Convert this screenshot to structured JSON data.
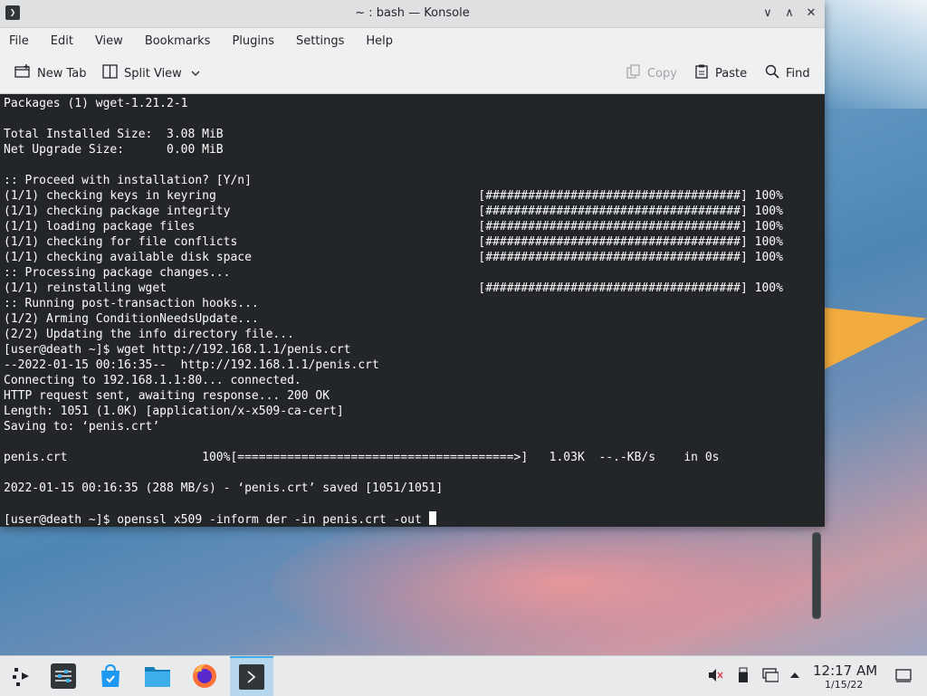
{
  "window": {
    "title": "~ : bash — Konsole",
    "app_icon_glyph": "❯",
    "controls": {
      "minimize": "∨",
      "maximize": "∧",
      "close": "✕"
    }
  },
  "menu": [
    "File",
    "Edit",
    "View",
    "Bookmarks",
    "Plugins",
    "Settings",
    "Help"
  ],
  "toolbar": {
    "new_tab": "New Tab",
    "split_view": "Split View",
    "copy": "Copy",
    "paste": "Paste",
    "find": "Find"
  },
  "terminal": {
    "lines": [
      "Packages (1) wget-1.21.2-1",
      "",
      "Total Installed Size:  3.08 MiB",
      "Net Upgrade Size:      0.00 MiB",
      "",
      ":: Proceed with installation? [Y/n]",
      "(1/1) checking keys in keyring                                     [####################################] 100%",
      "(1/1) checking package integrity                                   [####################################] 100%",
      "(1/1) loading package files                                        [####################################] 100%",
      "(1/1) checking for file conflicts                                  [####################################] 100%",
      "(1/1) checking available disk space                                [####################################] 100%",
      ":: Processing package changes...",
      "(1/1) reinstalling wget                                            [####################################] 100%",
      ":: Running post-transaction hooks...",
      "(1/2) Arming ConditionNeedsUpdate...",
      "(2/2) Updating the info directory file...",
      "[user@death ~]$ wget http://192.168.1.1/penis.crt",
      "--2022-01-15 00:16:35--  http://192.168.1.1/penis.crt",
      "Connecting to 192.168.1.1:80... connected.",
      "HTTP request sent, awaiting response... 200 OK",
      "Length: 1051 (1.0K) [application/x-x509-ca-cert]",
      "Saving to: ‘penis.crt’",
      "",
      "penis.crt                   100%[=======================================>]   1.03K  --.-KB/s    in 0s",
      "",
      "2022-01-15 00:16:35 (288 MB/s) - ‘penis.crt’ saved [1051/1051]",
      ""
    ],
    "prompt_line": "[user@death ~]$ openssl x509 -inform der -in penis.crt -out "
  },
  "taskbar": {
    "clock_time": "12:17 AM",
    "clock_date": "1/15/22"
  }
}
